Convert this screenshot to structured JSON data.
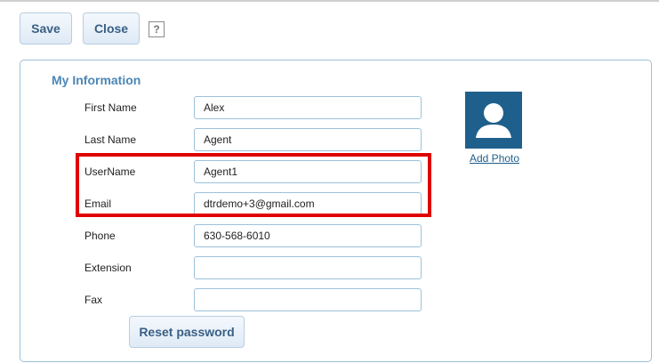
{
  "toolbar": {
    "save_label": "Save",
    "close_label": "Close",
    "help_label": "?"
  },
  "section": {
    "title": "My Information"
  },
  "fields": {
    "first_name": {
      "label": "First Name",
      "value": "Alex"
    },
    "last_name": {
      "label": "Last Name",
      "value": "Agent"
    },
    "username": {
      "label": "UserName",
      "value": "Agent1"
    },
    "email": {
      "label": "Email",
      "value": "dtrdemo+3@gmail.com"
    },
    "phone": {
      "label": "Phone",
      "value": "630-568-6010"
    },
    "extension": {
      "label": "Extension",
      "value": ""
    },
    "fax": {
      "label": "Fax",
      "value": ""
    }
  },
  "photo": {
    "icon": "user-silhouette-icon",
    "add_label": "Add Photo"
  },
  "actions": {
    "reset_password_label": "Reset password"
  },
  "colors": {
    "highlight": "#e00000",
    "accent": "#4b86b7",
    "photo_bg": "#1f5f8c"
  }
}
